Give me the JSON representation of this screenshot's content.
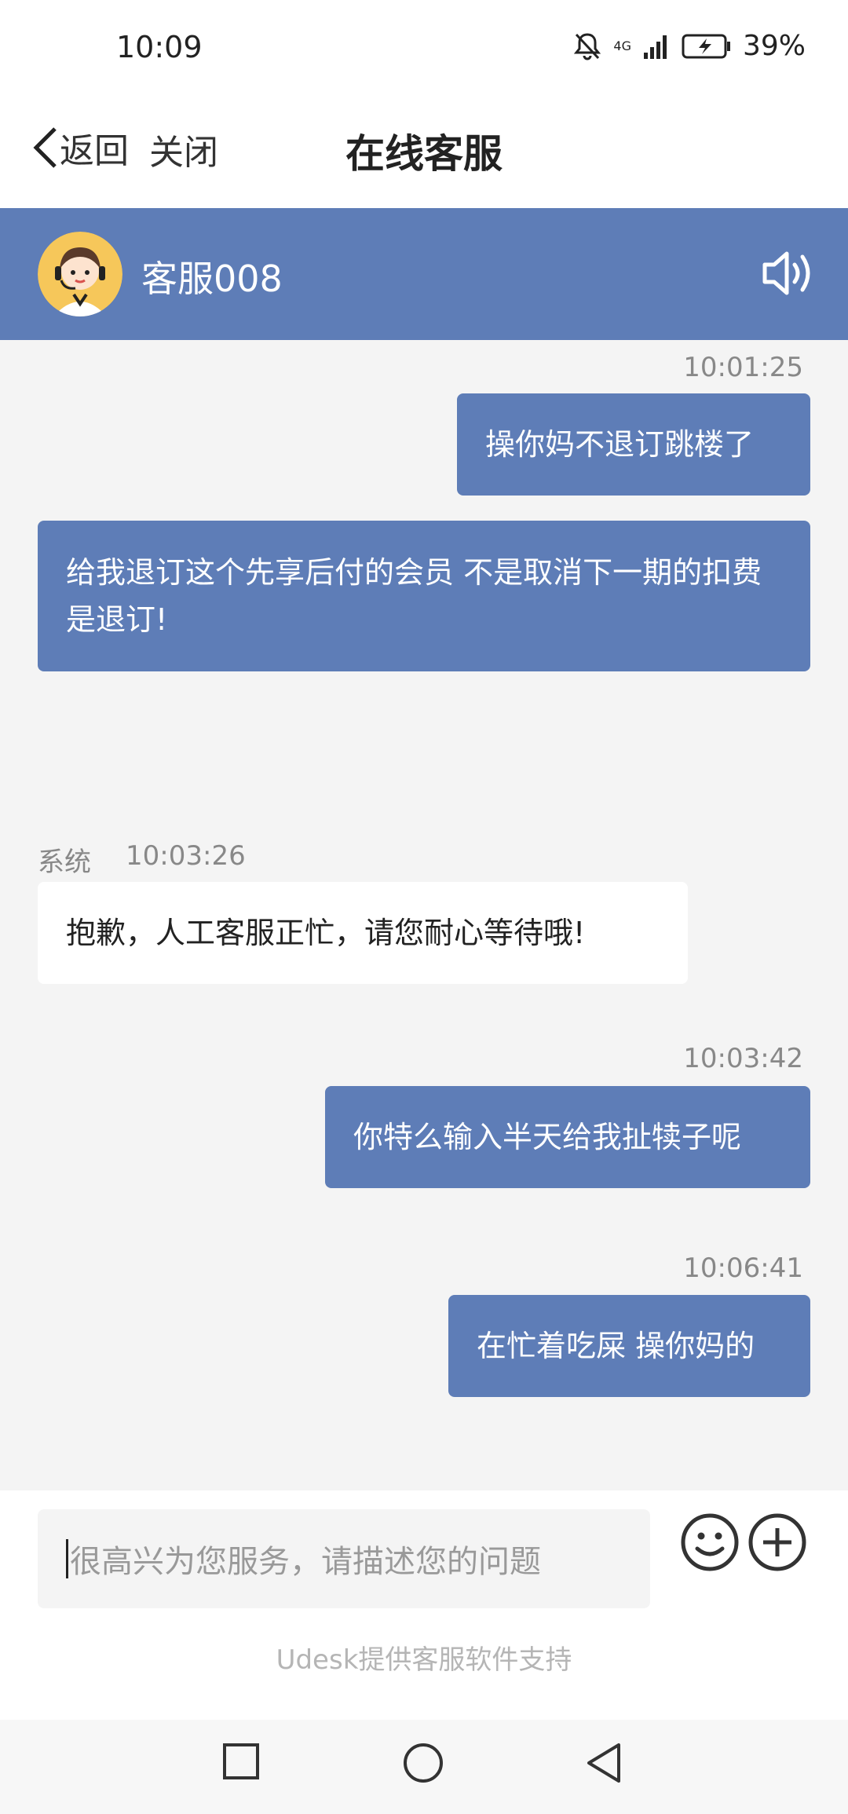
{
  "status_bar": {
    "time": "10:09",
    "battery": "39%",
    "network": "4G"
  },
  "nav": {
    "back_label": "返回",
    "close_label": "关闭",
    "title": "在线客服"
  },
  "agent": {
    "name": "客服008"
  },
  "messages": [
    {
      "time": "10:01:25",
      "text": "操你妈不退订跳楼了"
    },
    {
      "text": "给我退订这个先享后付的会员 不是取消下一期的扣费 是退订!"
    },
    {
      "sender": "系统",
      "time": "10:03:26",
      "text": "抱歉，人工客服正忙，请您耐心等待哦!"
    },
    {
      "time": "10:03:42",
      "text": "你特么输入半天给我扯犊子呢"
    },
    {
      "time": "10:06:41",
      "text": "在忙着吃屎 操你妈的"
    }
  ],
  "input": {
    "placeholder": "很高兴为您服务，请描述您的问题"
  },
  "footer": {
    "powered_by": "Udesk提供客服软件支持"
  },
  "colors": {
    "accent": "#5e7db7",
    "background": "#f4f4f4"
  }
}
